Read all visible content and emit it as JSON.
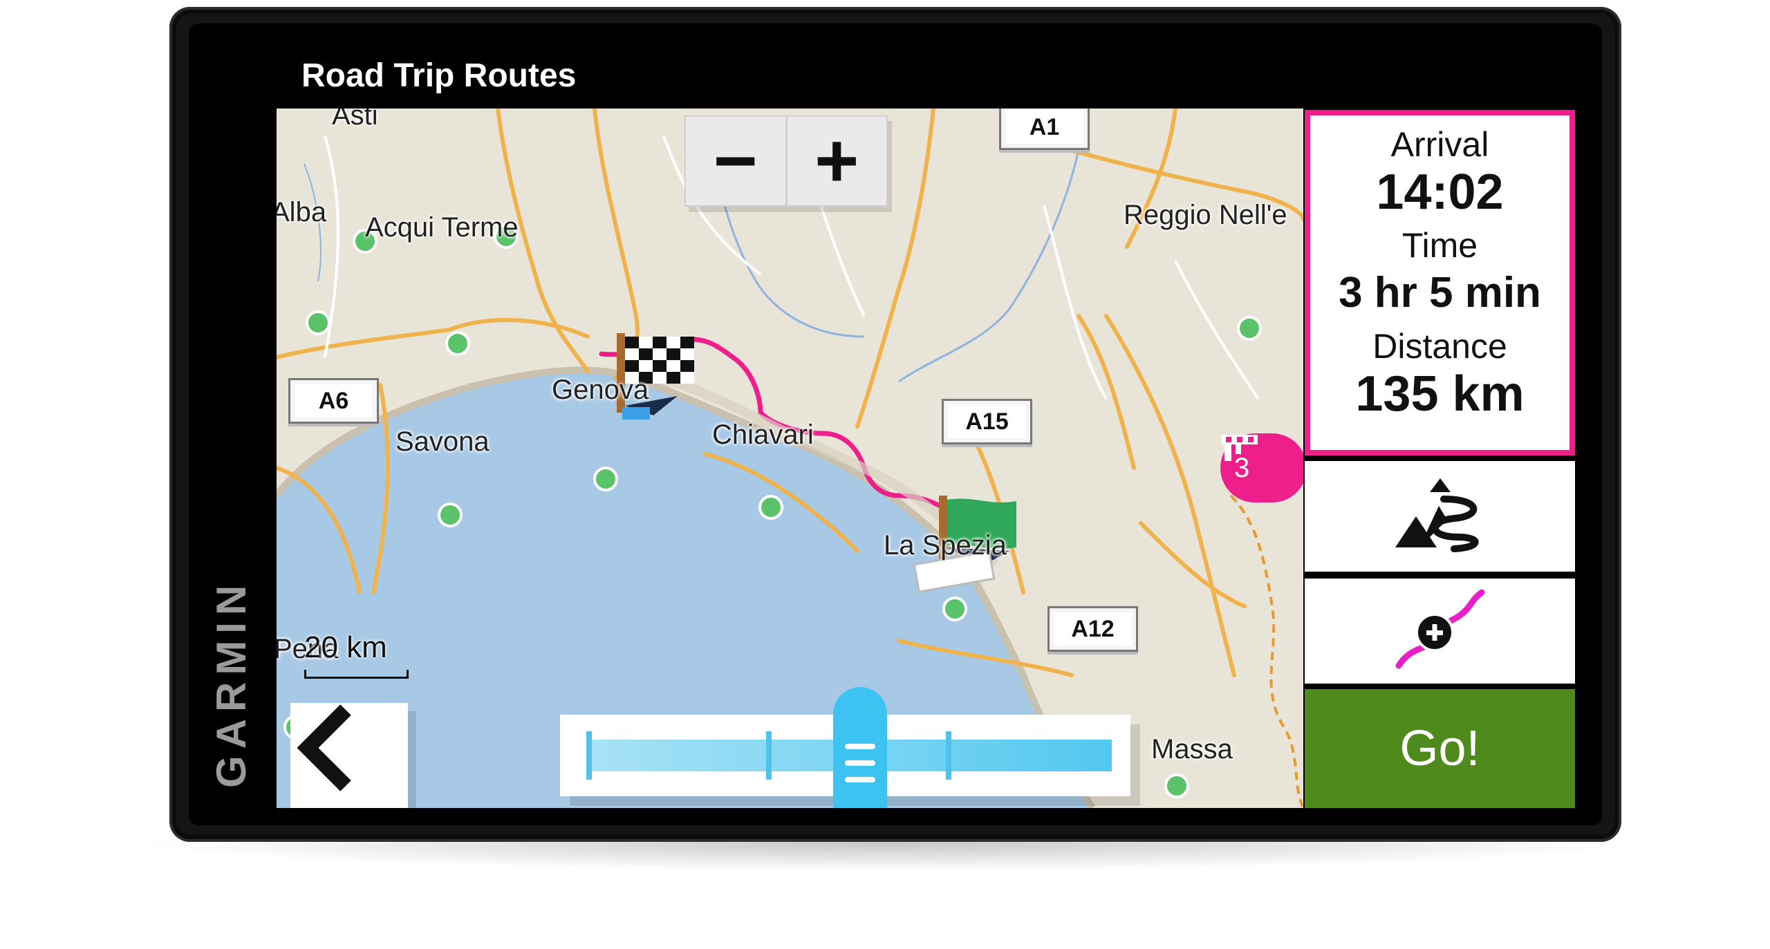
{
  "device": {
    "brand": "GARMIN"
  },
  "header": {
    "title": "Road Trip Routes"
  },
  "map": {
    "zoom_out_label": "−",
    "zoom_in_label": "+",
    "scale_label": "20 km",
    "towns": [
      "Asti",
      "Alba",
      "Acqui Terme",
      "Reggio Nell'e",
      "Genova",
      "Savona",
      "Chiavari",
      "La Spezia",
      "Pena",
      "Massa"
    ],
    "roads": [
      "A1",
      "A6",
      "A15",
      "A12"
    ],
    "toll_count": "3"
  },
  "route_info": {
    "arrival_label": "Arrival",
    "arrival_value": "14:02",
    "time_label": "Time",
    "time_value": "3 hr 5 min",
    "distance_label": "Distance",
    "distance_value": "135 km"
  },
  "actions": {
    "curvy_roads_icon": "curvy-road-mountains-icon",
    "add_shaping_icon": "add-shaping-point-icon",
    "go_label": "Go!"
  },
  "colors": {
    "accent": "#ee1f8a",
    "go": "#4f8a1d",
    "slider": "#3cc3f1",
    "water": "#a8c9e5"
  }
}
